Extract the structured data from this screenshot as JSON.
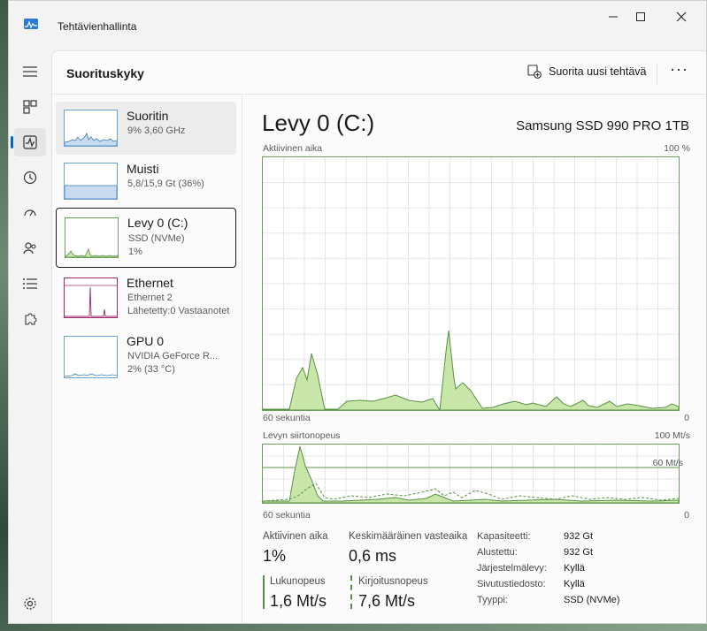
{
  "window": {
    "title": "Tehtävienhallinta"
  },
  "header": {
    "title": "Suorituskyky",
    "run_task_label": "Suorita uusi tehtävä",
    "more_label": "···"
  },
  "sidebar": {
    "items": [
      {
        "name": "Suoritin",
        "sub1": "9%  3,60 GHz",
        "sub2": "",
        "sub3": ""
      },
      {
        "name": "Muisti",
        "sub1": "5,8/15,9 Gt (36%)",
        "sub2": "",
        "sub3": ""
      },
      {
        "name": "Levy 0 (C:)",
        "sub1": "SSD (NVMe)",
        "sub2": "1%",
        "sub3": ""
      },
      {
        "name": "Ethernet",
        "sub1": "Ethernet 2",
        "sub2": "Lähetetty:0 Vastaanotet",
        "sub3": ""
      },
      {
        "name": "GPU 0",
        "sub1": "NVIDIA GeForce R...",
        "sub2": "2% (33 °C)",
        "sub3": ""
      }
    ]
  },
  "main": {
    "title": "Levy 0 (C:)",
    "model": "Samsung SSD 990 PRO 1TB",
    "graph1": {
      "label": "Aktiivinen aika",
      "max": "100 %",
      "time_left": "60 sekuntia",
      "time_right": "0"
    },
    "graph2": {
      "label": "Levyn siirtonopeus",
      "max": "100 Mt/s",
      "line_label": "60 Mt/s",
      "time_left": "60 sekuntia",
      "time_right": "0"
    },
    "stats": {
      "active_time_label": "Aktiivinen aika",
      "active_time_value": "1%",
      "avg_response_label": "Keskimääräinen vasteaika",
      "avg_response_value": "0,6 ms",
      "read_label": "Lukunopeus",
      "read_value": "1,6 Mt/s",
      "write_label": "Kirjoitusnopeus",
      "write_value": "7,6 Mt/s"
    },
    "props": [
      {
        "k": "Kapasiteetti:",
        "v": "932 Gt"
      },
      {
        "k": "Alustettu:",
        "v": "932 Gt"
      },
      {
        "k": "Järjestelmälevy:",
        "v": "Kyllä"
      },
      {
        "k": "Sivutustiedosto:",
        "v": "Kyllä"
      },
      {
        "k": "Tyyppi:",
        "v": "SSD (NVMe)"
      }
    ]
  },
  "colors": {
    "accent": "#0067c0",
    "disk_green": "#6ba05a",
    "disk_fill": "#c8e6a8",
    "cpu_blue": "#6a9fcf",
    "net_pink": "#a0286a"
  }
}
